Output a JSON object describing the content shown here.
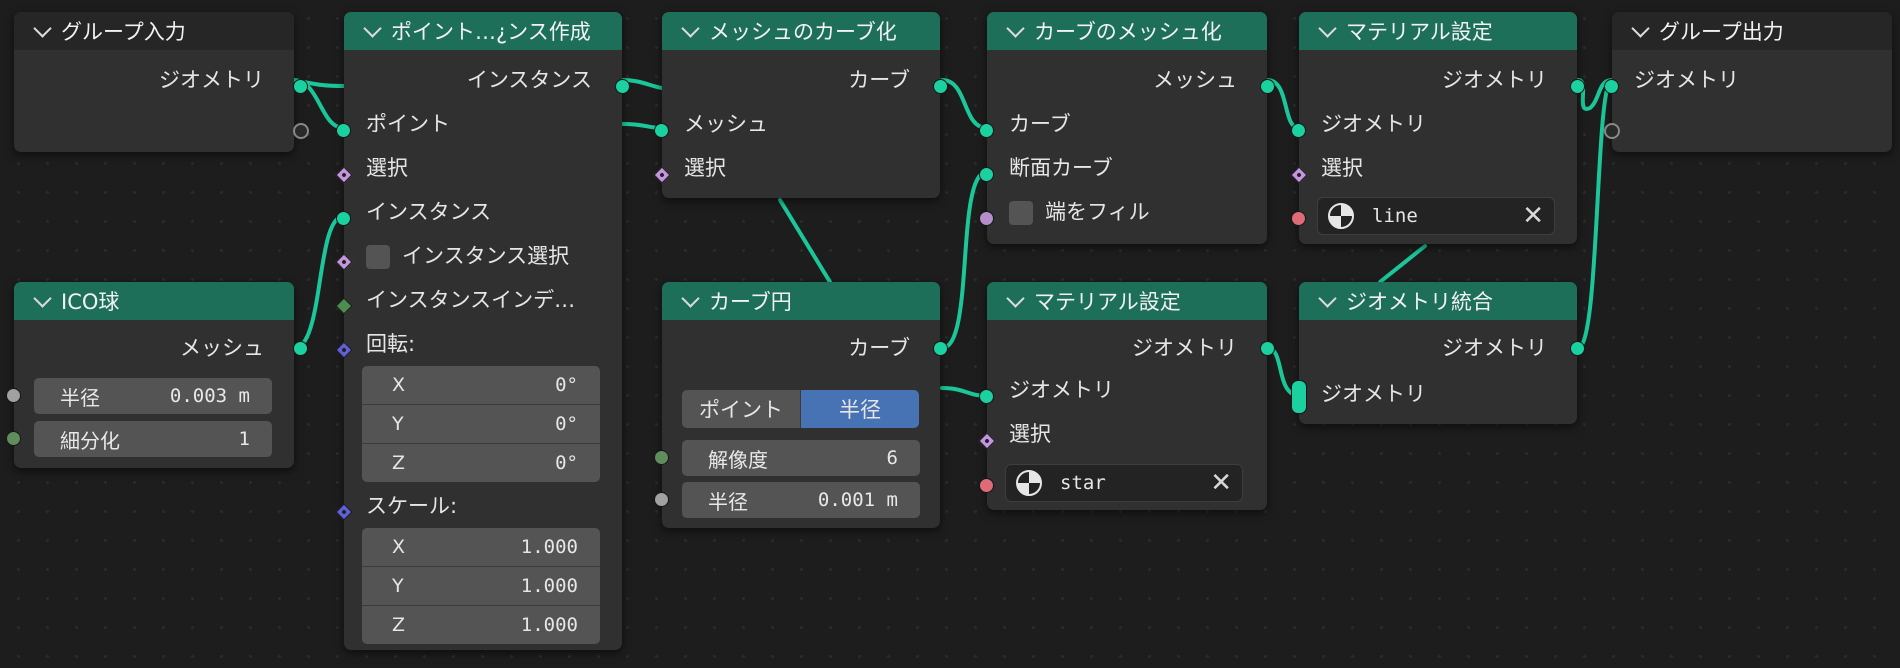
{
  "colors": {
    "geometry_socket": "#1bd1a0",
    "geometry_header": "#1e6f5a",
    "io_header": "#262626",
    "selected_mode": "#4772b3",
    "background": "#1d1d1d"
  },
  "group_input": {
    "title": "グループ入力",
    "geometry": "ジオメトリ"
  },
  "ico_sphere": {
    "title": "ICO球",
    "mesh": "メッシュ",
    "radius_label": "半径",
    "radius_value": "0.003 m",
    "subdiv_label": "細分化",
    "subdiv_value": "1"
  },
  "instance_on_points": {
    "title": "ポイント…¿ンス作成",
    "instances_out": "インスタンス",
    "points": "ポイント",
    "selection": "選択",
    "instance": "インスタンス",
    "instance_select": "インスタンス選択",
    "instance_index": "インスタンスインデ…",
    "rotation": "回転:",
    "rot_x_label": "X",
    "rot_x": "0°",
    "rot_y_label": "Y",
    "rot_y": "0°",
    "rot_z_label": "Z",
    "rot_z": "0°",
    "scale": "スケール:",
    "scale_x_label": "X",
    "scale_x": "1.000",
    "scale_y_label": "Y",
    "scale_y": "1.000",
    "scale_z_label": "Z",
    "scale_z": "1.000"
  },
  "mesh_to_curve": {
    "title": "メッシュのカーブ化",
    "curve_out": "カーブ",
    "mesh": "メッシュ",
    "selection": "選択"
  },
  "curve_circle": {
    "title": "カーブ円",
    "curve_out": "カーブ",
    "mode_points": "ポイント",
    "mode_radius": "半径",
    "resolution_label": "解像度",
    "resolution_value": "6",
    "radius_label": "半径",
    "radius_value": "0.001 m"
  },
  "curve_to_mesh": {
    "title": "カーブのメッシュ化",
    "mesh_out": "メッシュ",
    "curve": "カーブ",
    "profile": "断面カーブ",
    "fill_caps": "端をフィル"
  },
  "set_material_1": {
    "title": "マテリアル設定",
    "geometry_out": "ジオメトリ",
    "geometry": "ジオメトリ",
    "selection": "選択",
    "material": "line"
  },
  "set_material_2": {
    "title": "マテリアル設定",
    "geometry_out": "ジオメトリ",
    "geometry": "ジオメトリ",
    "selection": "選択",
    "material": "star"
  },
  "join_geometry": {
    "title": "ジオメトリ統合",
    "geometry_out": "ジオメトリ",
    "geometry": "ジオメトリ"
  },
  "group_output": {
    "title": "グループ出力",
    "geometry": "ジオメトリ"
  }
}
